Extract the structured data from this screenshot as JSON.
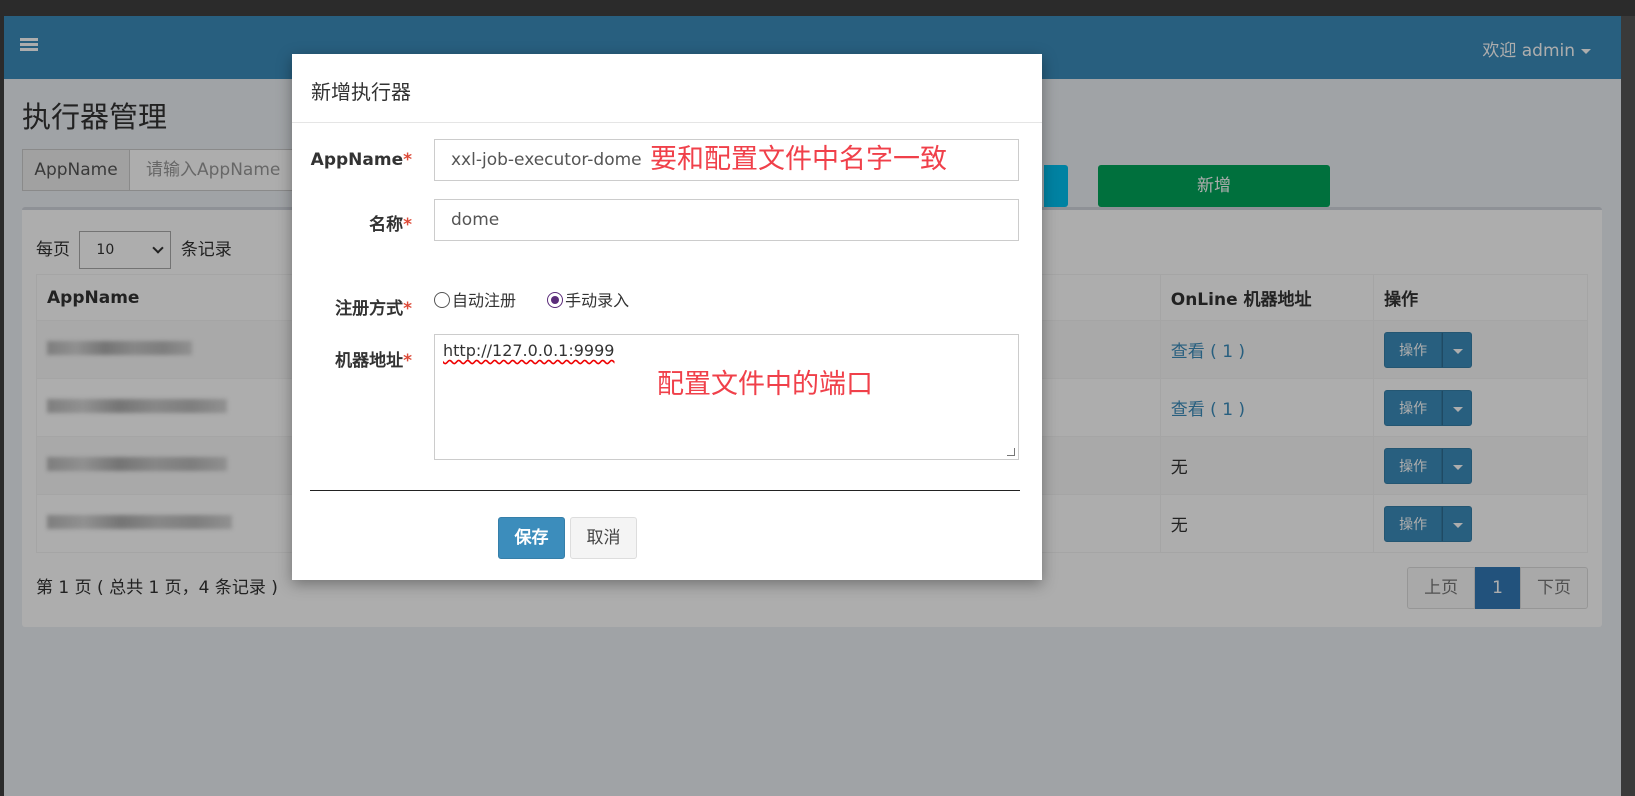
{
  "navbar": {
    "user_label": "欢迎 admin"
  },
  "page": {
    "title": "执行器管理"
  },
  "search": {
    "addon_label": "AppName",
    "placeholder": "请输入AppName",
    "add_button": "新增"
  },
  "list": {
    "per_page_prefix": "每页",
    "per_page_value": "10",
    "per_page_suffix": "条记录",
    "columns": {
      "appname": "AppName",
      "online": "OnLine 机器地址",
      "ops": "操作"
    },
    "rows": [
      {
        "online": "查看 ( 1 )",
        "op": "操作"
      },
      {
        "online": "查看 ( 1 )",
        "op": "操作"
      },
      {
        "online": "无",
        "op": "操作"
      },
      {
        "online": "无",
        "op": "操作"
      }
    ],
    "paging_info": "第 1 页 ( 总共 1 页，4 条记录 )",
    "pager": {
      "prev": "上页",
      "current": "1",
      "next": "下页"
    }
  },
  "modal": {
    "title": "新增执行器",
    "appname_label": "AppName",
    "appname_value": "xxl-job-executor-dome",
    "name_label": "名称",
    "name_value": "dome",
    "register_label": "注册方式",
    "radio_auto": "自动注册",
    "radio_manual": "手动录入",
    "address_label": "机器地址",
    "address_value": "http://127.0.0.1:9999",
    "required_mark": "*",
    "save": "保存",
    "cancel": "取消"
  },
  "annotations": {
    "appname_note": "要和配置文件中名字一致",
    "port_note": "配置文件中的端口"
  },
  "colors": {
    "navbar": "#3c8dbc",
    "add_button": "#00a65a",
    "annotation": "#f0404a",
    "required": "#dd4b39"
  }
}
